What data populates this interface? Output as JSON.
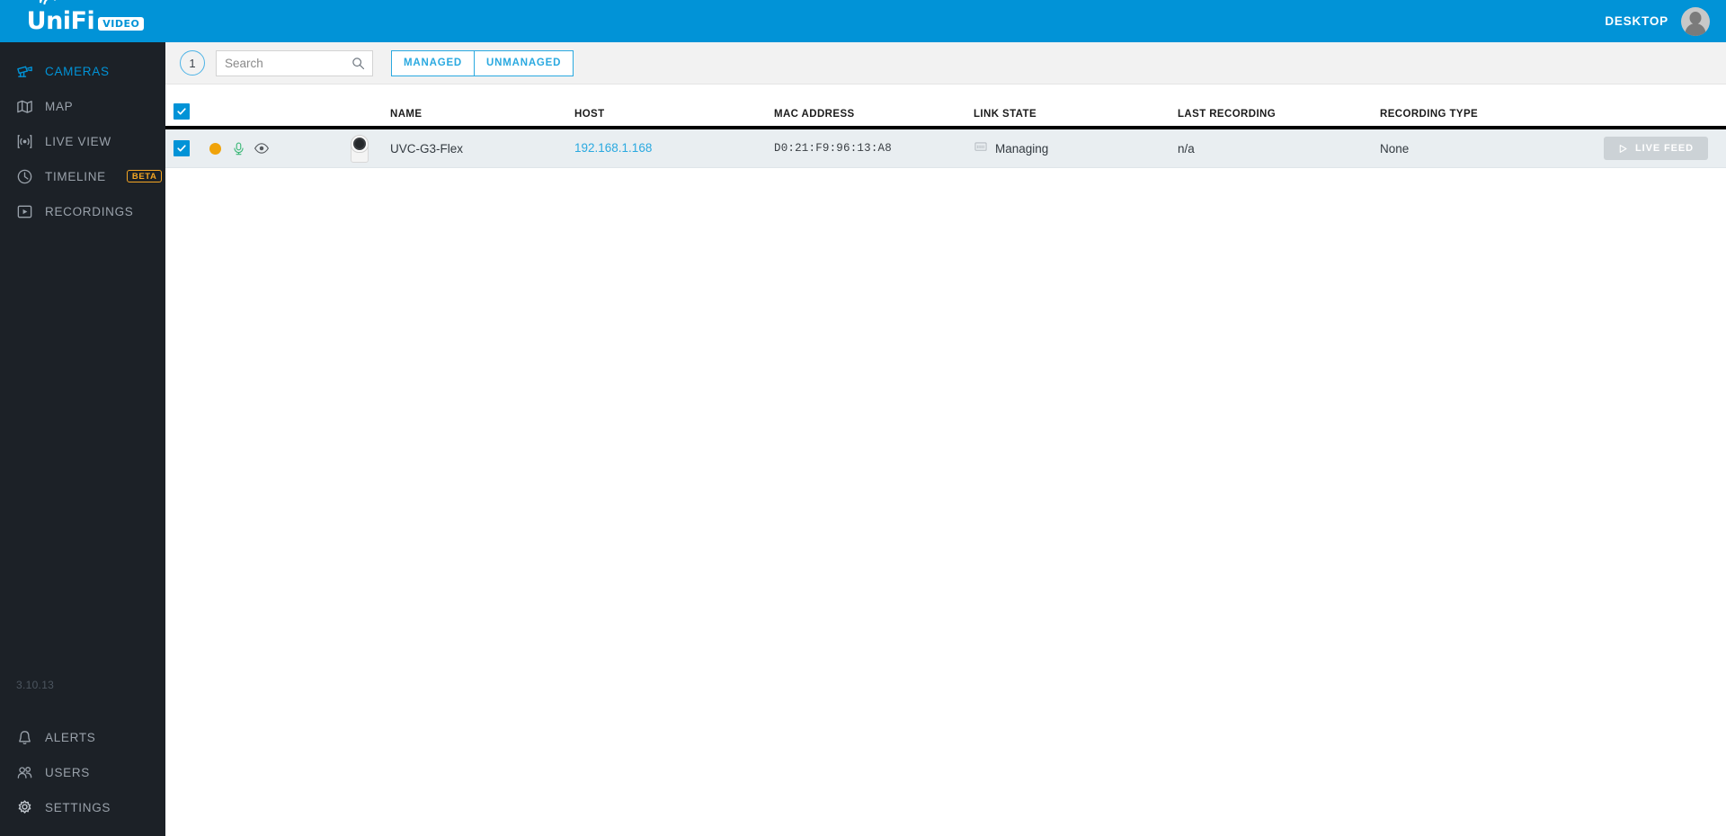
{
  "app": {
    "logo_text": "UniFi",
    "logo_badge": "VIDEO",
    "version": "3.10.13"
  },
  "header": {
    "desktop_label": "DESKTOP",
    "avatar_name": "user-avatar"
  },
  "sidebar": {
    "top_items": [
      {
        "label": "CAMERAS",
        "icon": "camera-icon",
        "active": true
      },
      {
        "label": "MAP",
        "icon": "map-icon",
        "active": false
      },
      {
        "label": "LIVE VIEW",
        "icon": "live-view-icon",
        "active": false
      },
      {
        "label": "TIMELINE",
        "icon": "clock-icon",
        "active": false,
        "badge": "BETA"
      },
      {
        "label": "RECORDINGS",
        "icon": "play-box-icon",
        "active": false
      }
    ],
    "bottom_items": [
      {
        "label": "ALERTS",
        "icon": "bell-icon"
      },
      {
        "label": "USERS",
        "icon": "users-icon"
      },
      {
        "label": "SETTINGS",
        "icon": "gear-icon"
      }
    ]
  },
  "toolbar": {
    "count": "1",
    "search_placeholder": "Search",
    "search_value": "",
    "filters": [
      {
        "label": "MANAGED"
      },
      {
        "label": "UNMANAGED"
      }
    ]
  },
  "table": {
    "columns": [
      "NAME",
      "HOST",
      "MAC ADDRESS",
      "LINK STATE",
      "LAST RECORDING",
      "RECORDING TYPE"
    ],
    "rows": [
      {
        "selected": true,
        "status": "recording-dot",
        "mic": "microphone-icon",
        "visibility": "eye-icon",
        "thumb": "camera-thumbnail",
        "name": "UVC-G3-Flex",
        "host": "192.168.1.168",
        "mac": "D0:21:F9:96:13:A8",
        "link_state": "Managing",
        "last_recording": "n/a",
        "recording_type": "None",
        "action_label": "LIVE FEED"
      }
    ]
  },
  "colors": {
    "brand_blue": "#0193d7",
    "accent_blue": "#2aa9e0",
    "sidebar_bg": "#1c2127",
    "status_orange": "#f0a30a",
    "beta_orange": "#f5a623",
    "row_bg": "#e9eef1"
  }
}
